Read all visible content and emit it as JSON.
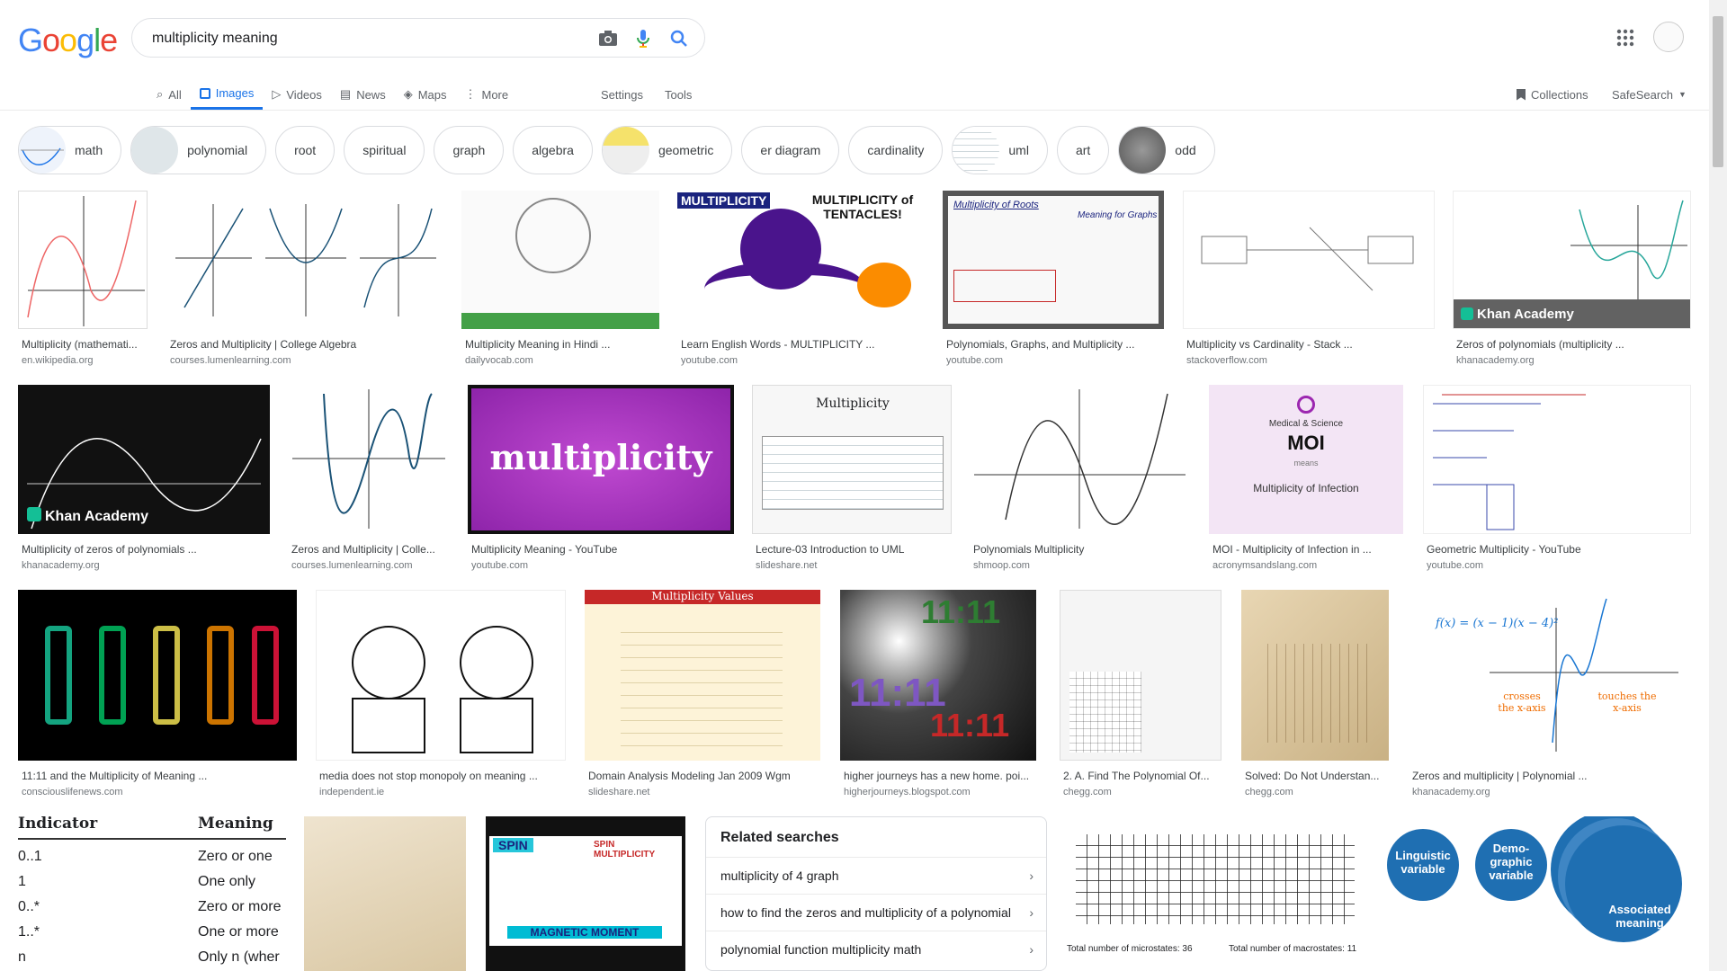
{
  "logo": {
    "letters": [
      "G",
      "o",
      "o",
      "g",
      "l",
      "e"
    ],
    "colors": [
      "#4285f4",
      "#ea4335",
      "#fbbc05",
      "#4285f4",
      "#34a853",
      "#ea4335"
    ]
  },
  "search": {
    "value": "multiplicity meaning"
  },
  "tabs": [
    {
      "label": "All",
      "icon": "search-icon"
    },
    {
      "label": "Images",
      "icon": "image-icon"
    },
    {
      "label": "Videos",
      "icon": "video-icon"
    },
    {
      "label": "News",
      "icon": "news-icon"
    },
    {
      "label": "Maps",
      "icon": "map-icon"
    },
    {
      "label": "More",
      "icon": "more-dots-icon"
    }
  ],
  "settings_label": "Settings",
  "tools_label": "Tools",
  "collections_label": "Collections",
  "safesearch_label": "SafeSearch",
  "chips": [
    "math",
    "polynomial",
    "root",
    "spiritual",
    "graph",
    "algebra",
    "geometric",
    "er diagram",
    "cardinality",
    "uml",
    "art",
    "odd"
  ],
  "results": [
    {
      "caption": "Multiplicity (mathemati...",
      "source": "en.wikipedia.org"
    },
    {
      "caption": "Zeros and Multiplicity | College Algebra",
      "source": "courses.lumenlearning.com"
    },
    {
      "caption": "Multiplicity Meaning in Hindi ...",
      "source": "dailyvocab.com"
    },
    {
      "caption": "Learn English Words - MULTIPLICITY ...",
      "source": "youtube.com"
    },
    {
      "caption": "Polynomials, Graphs, and Multiplicity ...",
      "source": "youtube.com"
    },
    {
      "caption": "Multiplicity vs Cardinality - Stack ...",
      "source": "stackoverflow.com"
    },
    {
      "caption": "Zeros of polynomials (multiplicity ...",
      "source": "khanacademy.org"
    },
    {
      "caption": "Multiplicity of zeros of polynomials ...",
      "source": "khanacademy.org"
    },
    {
      "caption": "Zeros and Multiplicity | Colle...",
      "source": "courses.lumenlearning.com"
    },
    {
      "caption": "Multiplicity Meaning - YouTube",
      "source": "youtube.com"
    },
    {
      "caption": "Lecture-03 Introduction to UML",
      "source": "slideshare.net"
    },
    {
      "caption": "Polynomials Multiplicity",
      "source": "shmoop.com"
    },
    {
      "caption": "MOI - Multiplicity of Infection in ...",
      "source": "acronymsandslang.com"
    },
    {
      "caption": "Geometric Multiplicity - YouTube",
      "source": "youtube.com"
    },
    {
      "caption": "11:11 and the Multiplicity of Meaning ...",
      "source": "consciouslifenews.com"
    },
    {
      "caption": "media does not stop monopoly on meaning ...",
      "source": "independent.ie"
    },
    {
      "caption": "Domain Analysis Modeling Jan 2009 Wgm",
      "source": "slideshare.net"
    },
    {
      "caption": "higher journeys has a new home. poi...",
      "source": "higherjourneys.blogspot.com"
    },
    {
      "caption": "2. A. Find The Polynomial Of...",
      "source": "chegg.com"
    },
    {
      "caption": "Solved: Do Not Understan...",
      "source": "chegg.com"
    },
    {
      "caption": "Zeros and multiplicity | Polynomial ...",
      "source": "khanacademy.org"
    }
  ],
  "thumb_text": {
    "multiplicity_word": "multiplicity",
    "khan": "Khan Academy",
    "octopus_title": "MULTIPLICITY",
    "octopus_sub": "MULTIPLICITY of TENTACLES!",
    "uml_title": "Multiplicity",
    "moi_small": "Medical & Science",
    "moi_big": "MOI",
    "moi_means": "means",
    "moi_full": "Multiplicity of Infection",
    "values_title": "Multiplicity Values",
    "clock_text": "11:11",
    "indicator_head": "Indicator",
    "meaning_head": "Meaning",
    "indicator_rows": [
      [
        "0..1",
        "Zero or one"
      ],
      [
        "1",
        "One only"
      ],
      [
        "0..*",
        "Zero or more"
      ],
      [
        "1..*",
        "One or more"
      ],
      [
        "n",
        "Only n (wher"
      ]
    ],
    "spin_title": "SPIN MULTIPLICITY",
    "spin_sub": "MAGNETIC MOMENT",
    "spin_label": "SPIN",
    "micro_left": "Total number of microstates: 36",
    "micro_right": "Total number of macrostates: 11",
    "bubble1": "Linguistic variable",
    "bubble2": "Demo-graphic variable",
    "bubble3": "Associated meaning",
    "fx": "f(x) = (x − 1)(x − 4)²",
    "crosses": "crosses the x-axis",
    "touches": "touches the x-axis",
    "chalk1": "Multiplicity of Roots",
    "chalk2": "Meaning for Graphs"
  },
  "related": {
    "title": "Related searches",
    "items": [
      "multiplicity of 4 graph",
      "how to find the zeros and multiplicity of a polynomial",
      "polynomial function multiplicity math"
    ]
  }
}
